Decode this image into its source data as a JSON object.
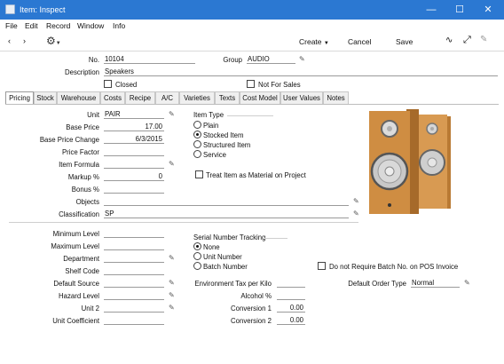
{
  "window": {
    "title": "Item: Inspect"
  },
  "menubar": [
    "File",
    "Edit",
    "Record",
    "Window",
    "Info"
  ],
  "toolbar": {
    "create": "Create",
    "cancel": "Cancel",
    "save": "Save"
  },
  "header": {
    "no_label": "No.",
    "no_value": "10104",
    "group_label": "Group",
    "group_value": "AUDIO",
    "description_label": "Description",
    "description_value": "Speakers",
    "closed_label": "Closed",
    "not_for_sales_label": "Not For Sales"
  },
  "tabs": [
    "Pricing",
    "Stock",
    "Warehouse",
    "Costs",
    "Recipe",
    "A/C",
    "Varieties",
    "Texts",
    "Cost Model",
    "User Values",
    "Notes"
  ],
  "pricing": {
    "unit_label": "Unit",
    "unit_value": "PAIR",
    "base_price_label": "Base Price",
    "base_price_value": "17.00",
    "base_price_change_label": "Base Price Change",
    "base_price_change_value": "6/3/2015",
    "price_factor_label": "Price Factor",
    "price_factor_value": "",
    "item_formula_label": "Item Formula",
    "item_formula_value": "",
    "markup_label": "Markup %",
    "markup_value": "0",
    "bonus_label": "Bonus %",
    "bonus_value": "",
    "objects_label": "Objects",
    "objects_value": "",
    "classification_label": "Classification",
    "classification_value": "SP",
    "item_type_label": "Item Type",
    "item_type_options": [
      "Plain",
      "Stocked Item",
      "Structured Item",
      "Service"
    ],
    "item_type_selected": "Stocked Item",
    "treat_material_label": "Treat Item as Material on Project",
    "min_level_label": "Minimum Level",
    "max_level_label": "Maximum Level",
    "department_label": "Department",
    "shelf_code_label": "Shelf Code",
    "default_source_label": "Default Source",
    "hazard_level_label": "Hazard Level",
    "unit2_label": "Unit 2",
    "unit_coefficient_label": "Unit Coefficient",
    "serial_tracking_label": "Serial Number Tracking",
    "serial_options": [
      "None",
      "Unit Number",
      "Batch Number"
    ],
    "serial_selected": "None",
    "no_batch_label": "Do not Require Batch No. on POS Invoice",
    "env_tax_label": "Environment Tax per Kilo",
    "alcohol_label": "Alcohol %",
    "conversion1_label": "Conversion 1",
    "conversion1_value": "0.00",
    "conversion2_label": "Conversion 2",
    "conversion2_value": "0.00",
    "default_order_type_label": "Default Order Type",
    "default_order_type_value": "Normal"
  },
  "colors": {
    "titlebar": "#2b78d2",
    "speaker_wood": "#c98a3c",
    "speaker_cone": "#bdbdbd"
  }
}
